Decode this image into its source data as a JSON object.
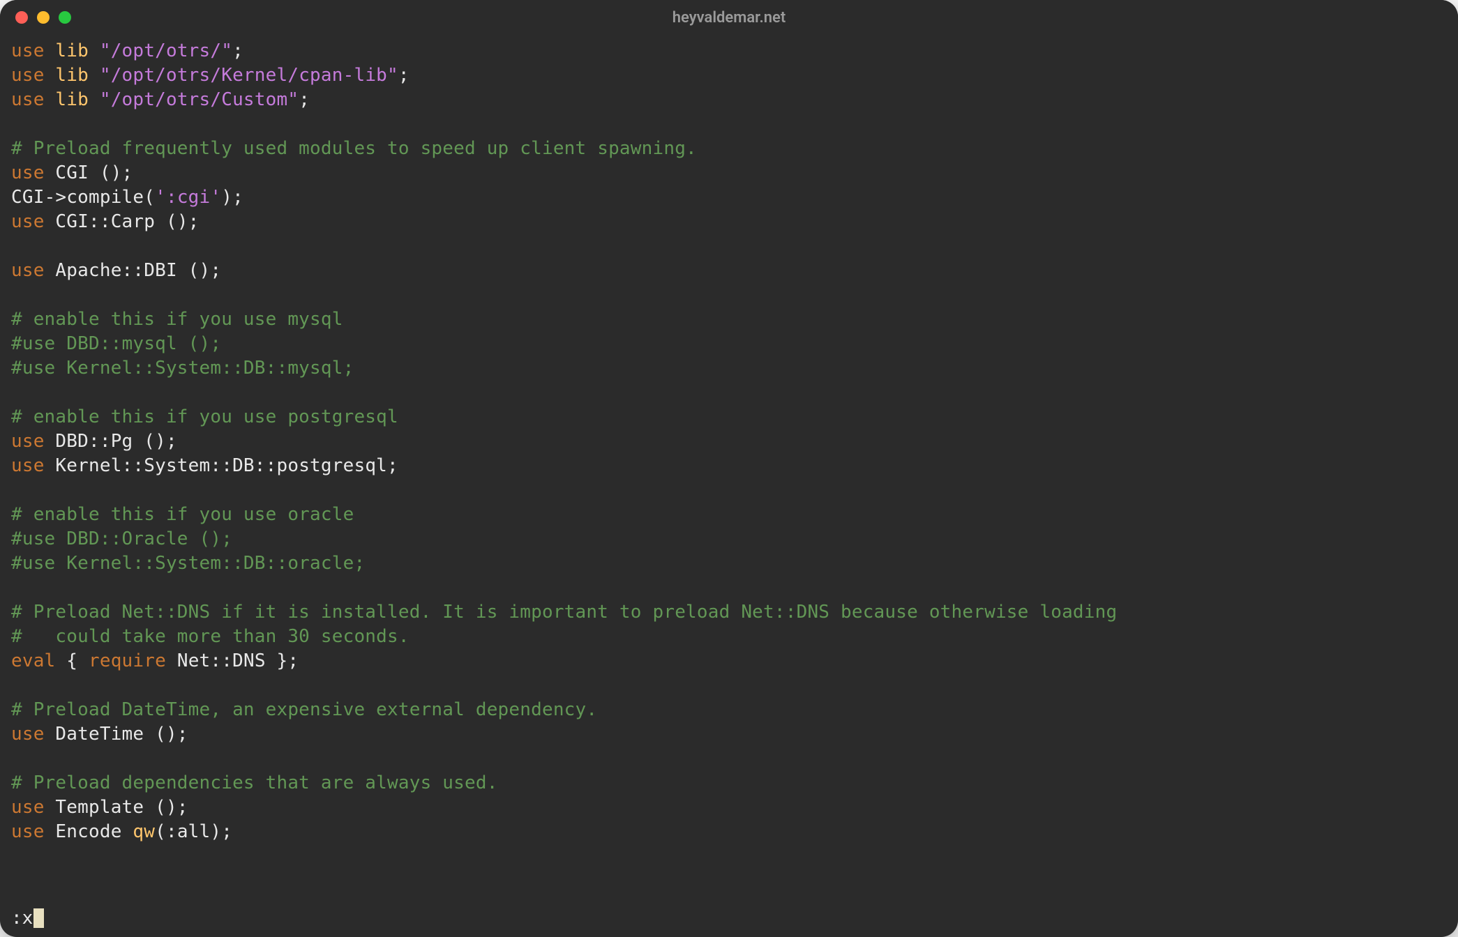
{
  "window": {
    "title": "heyvaldemar.net"
  },
  "colors": {
    "background": "#2b2b2b",
    "keyword": "#cc7832",
    "function": "#ffc66d",
    "string": "#c57bdb",
    "comment": "#629755",
    "foreground": "#e8e8e8",
    "cursor": "#e8e0c0",
    "traffic_close": "#ff5f57",
    "traffic_min": "#febc2e",
    "traffic_max": "#28c840"
  },
  "code": {
    "lines": [
      [
        [
          "kw",
          "use"
        ],
        [
          "punc",
          " "
        ],
        [
          "func",
          "lib"
        ],
        [
          "punc",
          " "
        ],
        [
          "str",
          "\"/opt/otrs/\""
        ],
        [
          "punc",
          ";"
        ]
      ],
      [
        [
          "kw",
          "use"
        ],
        [
          "punc",
          " "
        ],
        [
          "func",
          "lib"
        ],
        [
          "punc",
          " "
        ],
        [
          "str",
          "\"/opt/otrs/Kernel/cpan-lib\""
        ],
        [
          "punc",
          ";"
        ]
      ],
      [
        [
          "kw",
          "use"
        ],
        [
          "punc",
          " "
        ],
        [
          "func",
          "lib"
        ],
        [
          "punc",
          " "
        ],
        [
          "str",
          "\"/opt/otrs/Custom\""
        ],
        [
          "punc",
          ";"
        ]
      ],
      [],
      [
        [
          "cmt",
          "# Preload frequently used modules to speed up client spawning."
        ]
      ],
      [
        [
          "kw",
          "use"
        ],
        [
          "punc",
          " "
        ],
        [
          "id",
          "CGI"
        ],
        [
          "punc",
          " ();"
        ]
      ],
      [
        [
          "id",
          "CGI"
        ],
        [
          "arrow",
          "->"
        ],
        [
          "id",
          "compile"
        ],
        [
          "punc",
          "("
        ],
        [
          "str",
          "':cgi'"
        ],
        [
          "punc",
          ");"
        ]
      ],
      [
        [
          "kw",
          "use"
        ],
        [
          "punc",
          " "
        ],
        [
          "id",
          "CGI::Carp"
        ],
        [
          "punc",
          " ();"
        ]
      ],
      [],
      [
        [
          "kw",
          "use"
        ],
        [
          "punc",
          " "
        ],
        [
          "id",
          "Apache::DBI"
        ],
        [
          "punc",
          " ();"
        ]
      ],
      [],
      [
        [
          "cmt",
          "# enable this if you use mysql"
        ]
      ],
      [
        [
          "cmt",
          "#use DBD::mysql ();"
        ]
      ],
      [
        [
          "cmt",
          "#use Kernel::System::DB::mysql;"
        ]
      ],
      [],
      [
        [
          "cmt",
          "# enable this if you use postgresql"
        ]
      ],
      [
        [
          "kw",
          "use"
        ],
        [
          "punc",
          " "
        ],
        [
          "id",
          "DBD::Pg"
        ],
        [
          "punc",
          " ();"
        ]
      ],
      [
        [
          "kw",
          "use"
        ],
        [
          "punc",
          " "
        ],
        [
          "id",
          "Kernel::System::DB::postgresql"
        ],
        [
          "punc",
          ";"
        ]
      ],
      [],
      [
        [
          "cmt",
          "# enable this if you use oracle"
        ]
      ],
      [
        [
          "cmt",
          "#use DBD::Oracle ();"
        ]
      ],
      [
        [
          "cmt",
          "#use Kernel::System::DB::oracle;"
        ]
      ],
      [],
      [
        [
          "cmt",
          "# Preload Net::DNS if it is installed. It is important to preload Net::DNS because otherwise loading"
        ]
      ],
      [
        [
          "cmt",
          "#   could take more than 30 seconds."
        ]
      ],
      [
        [
          "kw",
          "eval"
        ],
        [
          "punc",
          " "
        ],
        [
          "brace",
          "{"
        ],
        [
          "punc",
          " "
        ],
        [
          "kw",
          "require"
        ],
        [
          "punc",
          " "
        ],
        [
          "id",
          "Net::DNS"
        ],
        [
          "punc",
          " "
        ],
        [
          "brace",
          "}"
        ],
        [
          "punc",
          ";"
        ]
      ],
      [],
      [
        [
          "cmt",
          "# Preload DateTime, an expensive external dependency."
        ]
      ],
      [
        [
          "kw",
          "use"
        ],
        [
          "punc",
          " "
        ],
        [
          "id",
          "DateTime"
        ],
        [
          "punc",
          " ();"
        ]
      ],
      [],
      [
        [
          "cmt",
          "# Preload dependencies that are always used."
        ]
      ],
      [
        [
          "kw",
          "use"
        ],
        [
          "punc",
          " "
        ],
        [
          "id",
          "Template"
        ],
        [
          "punc",
          " ();"
        ]
      ],
      [
        [
          "kw",
          "use"
        ],
        [
          "punc",
          " "
        ],
        [
          "id",
          "Encode"
        ],
        [
          "punc",
          " "
        ],
        [
          "func",
          "qw"
        ],
        [
          "punc",
          "(:all);"
        ]
      ]
    ]
  },
  "status": {
    "command": ":x"
  }
}
